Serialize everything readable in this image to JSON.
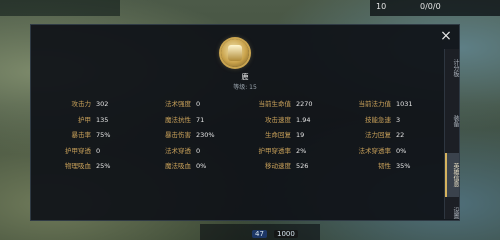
{
  "hud": {
    "score_left": "10",
    "score_right": "0/0/0",
    "bottom_value": "47",
    "bottom_value_2": "1000"
  },
  "panel": {
    "close_glyph": "×",
    "hero": {
      "name": "鹿",
      "level_text": "等级: 15"
    }
  },
  "stats": [
    [
      {
        "label": "攻击力",
        "value": "302"
      },
      {
        "label": "法术强度",
        "value": "0"
      },
      {
        "label": "当前生命值",
        "value": "2270"
      },
      {
        "label": "当前法力值",
        "value": "1031"
      }
    ],
    [
      {
        "label": "护甲",
        "value": "135"
      },
      {
        "label": "魔法抗性",
        "value": "71"
      },
      {
        "label": "攻击速度",
        "value": "1.94"
      },
      {
        "label": "技能急速",
        "value": "3"
      }
    ],
    [
      {
        "label": "暴击率",
        "value": "75%"
      },
      {
        "label": "暴击伤害",
        "value": "230%"
      },
      {
        "label": "生命回复",
        "value": "19"
      },
      {
        "label": "法力回复",
        "value": "22"
      }
    ],
    [
      {
        "label": "护甲穿透",
        "value": "0"
      },
      {
        "label": "法术穿透",
        "value": "0"
      },
      {
        "label": "护甲穿透率",
        "value": "2%"
      },
      {
        "label": "法术穿透率",
        "value": "0%"
      }
    ],
    [
      {
        "label": "物理吸血",
        "value": "25%"
      },
      {
        "label": "魔法吸血",
        "value": "0%"
      },
      {
        "label": "移动速度",
        "value": "526"
      },
      {
        "label": "韧性",
        "value": "35%"
      }
    ]
  ],
  "tabs": [
    {
      "label": "计分板"
    },
    {
      "label": "装备"
    },
    {
      "label": "英雄信息"
    },
    {
      "label": "设置"
    }
  ]
}
